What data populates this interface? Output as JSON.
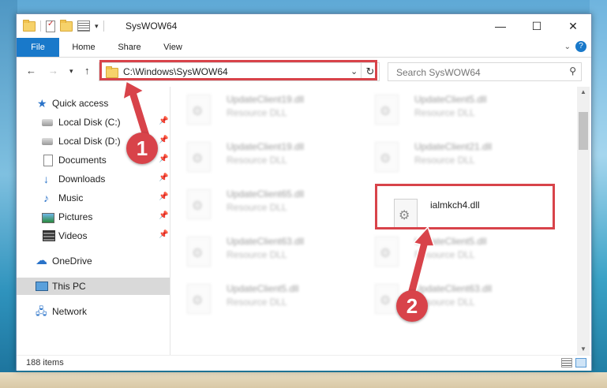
{
  "window": {
    "title": "SysWOW64"
  },
  "ribbon": {
    "tabs": [
      "File",
      "Home",
      "Share",
      "View"
    ]
  },
  "navbar": {
    "address": "C:\\Windows\\SysWOW64",
    "search_placeholder": "Search SysWOW64"
  },
  "nav_pane": {
    "items": [
      {
        "label": "Quick access",
        "icon": "star-icon"
      },
      {
        "label": "Local Disk (C:)",
        "icon": "disk-icon",
        "pinned": true
      },
      {
        "label": "Local Disk (D:)",
        "icon": "disk-icon",
        "pinned": true
      },
      {
        "label": "Documents",
        "icon": "documents-icon",
        "pinned": true
      },
      {
        "label": "Downloads",
        "icon": "download-icon",
        "pinned": true
      },
      {
        "label": "Music",
        "icon": "music-icon",
        "pinned": true
      },
      {
        "label": "Pictures",
        "icon": "pictures-icon",
        "pinned": true
      },
      {
        "label": "Videos",
        "icon": "videos-icon",
        "pinned": true
      },
      {
        "label": "OneDrive",
        "icon": "cloud-icon"
      },
      {
        "label": "This PC",
        "icon": "pc-icon",
        "selected": true
      },
      {
        "label": "Network",
        "icon": "network-icon"
      }
    ]
  },
  "files": [
    {
      "name": "UpdateClient19.dll",
      "type": "Resource DLL"
    },
    {
      "name": "UpdateClient5.dll",
      "type": "Resource DLL"
    },
    {
      "name": "UpdateClient19.dll",
      "type": "Resource DLL"
    },
    {
      "name": "UpdateClient21.dll",
      "type": "Resource DLL"
    },
    {
      "name": "UpdateClient65.dll",
      "type": "Resource DLL"
    },
    {
      "name": "ialmkch4.dll",
      "type": ""
    },
    {
      "name": "UpdateClient63.dll",
      "type": "Resource DLL"
    },
    {
      "name": "UpdateClient5.dll",
      "type": "Resource DLL"
    },
    {
      "name": "UpdateClient5.dll",
      "type": "Resource DLL"
    },
    {
      "name": "UpdateClient63.dll",
      "type": "Resource DLL"
    }
  ],
  "status": {
    "item_count": "188 items"
  },
  "annotations": {
    "marker_1": "1",
    "marker_2": "2",
    "highlight_color": "#d8434a"
  },
  "colors": {
    "accent": "#1979ca"
  }
}
